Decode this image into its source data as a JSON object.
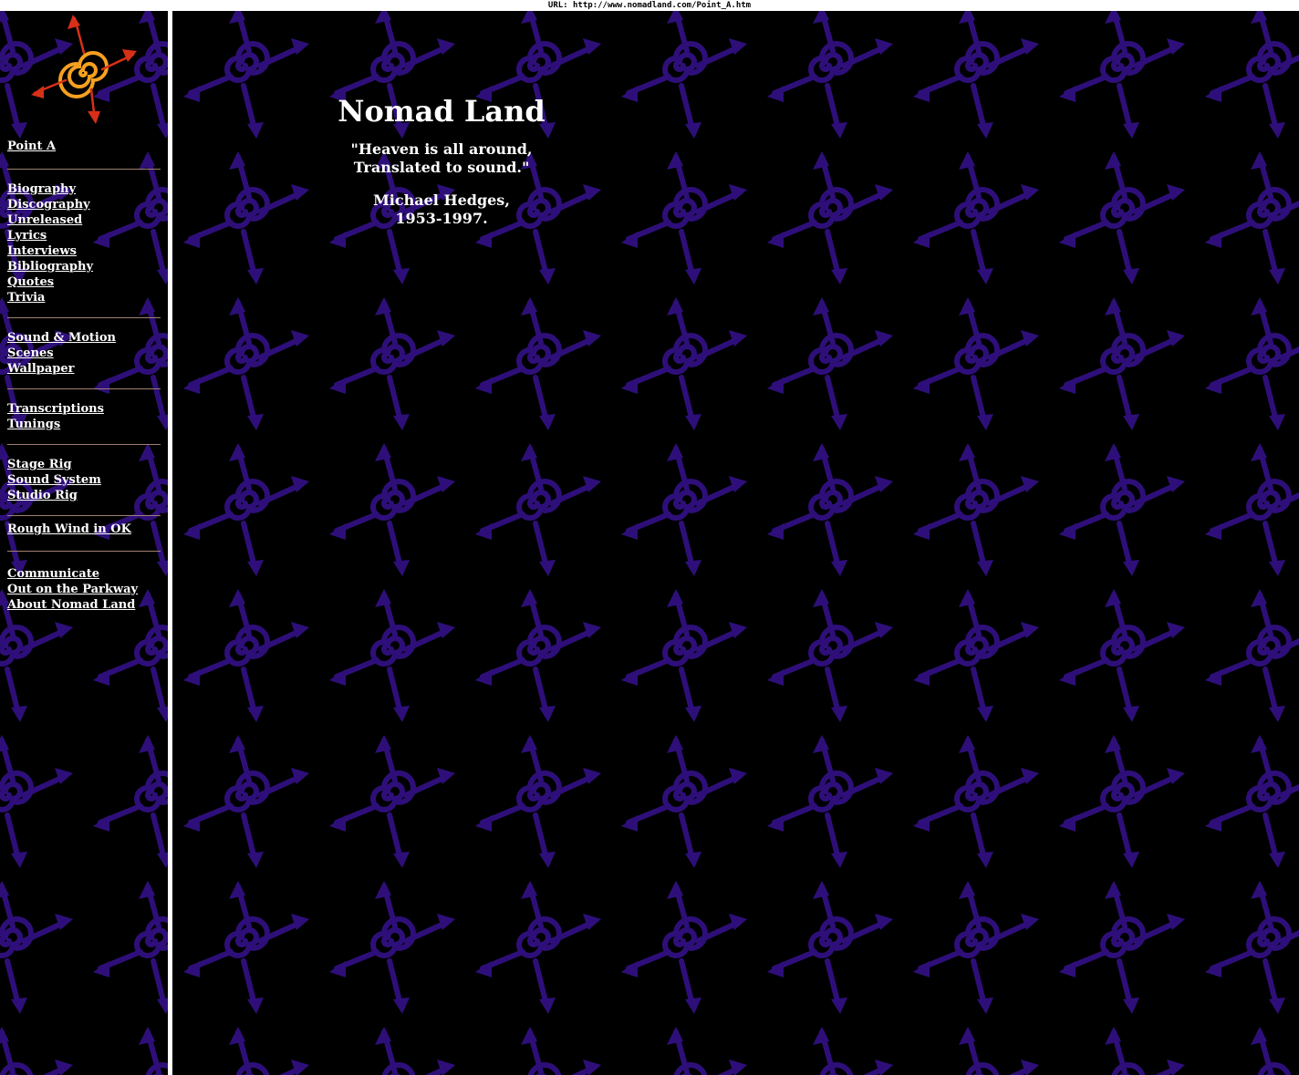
{
  "browser": {
    "url_label": "URL:",
    "url": "http://www.nomadland.com/Point_A.htm"
  },
  "sidebar": {
    "point_a": "Point A",
    "group1": [
      "Biography",
      "Discography",
      "Unreleased",
      "Lyrics",
      "Interviews",
      "Bibliography",
      "Quotes",
      "Trivia"
    ],
    "group2": [
      "Sound & Motion",
      "Scenes",
      "Wallpaper"
    ],
    "group3": [
      "Transcriptions",
      "Tunings"
    ],
    "group4": [
      "Stage Rig",
      "Sound System",
      "Studio Rig"
    ],
    "group5": [
      "Rough Wind in OK"
    ],
    "group6": [
      "Communicate",
      "Out on the Parkway",
      "About Nomad Land"
    ]
  },
  "main": {
    "title": "Nomad Land",
    "quote_line1": "\"Heaven is all around,",
    "quote_line2": "Translated to sound.\"",
    "author_line1": "Michael Hedges,",
    "author_line2": "1953-1997."
  },
  "colors": {
    "background": "#000000",
    "pattern": "#2e0f7a",
    "text": "#ffffff",
    "logo_orange": "#f5a020",
    "logo_red": "#d83018"
  }
}
